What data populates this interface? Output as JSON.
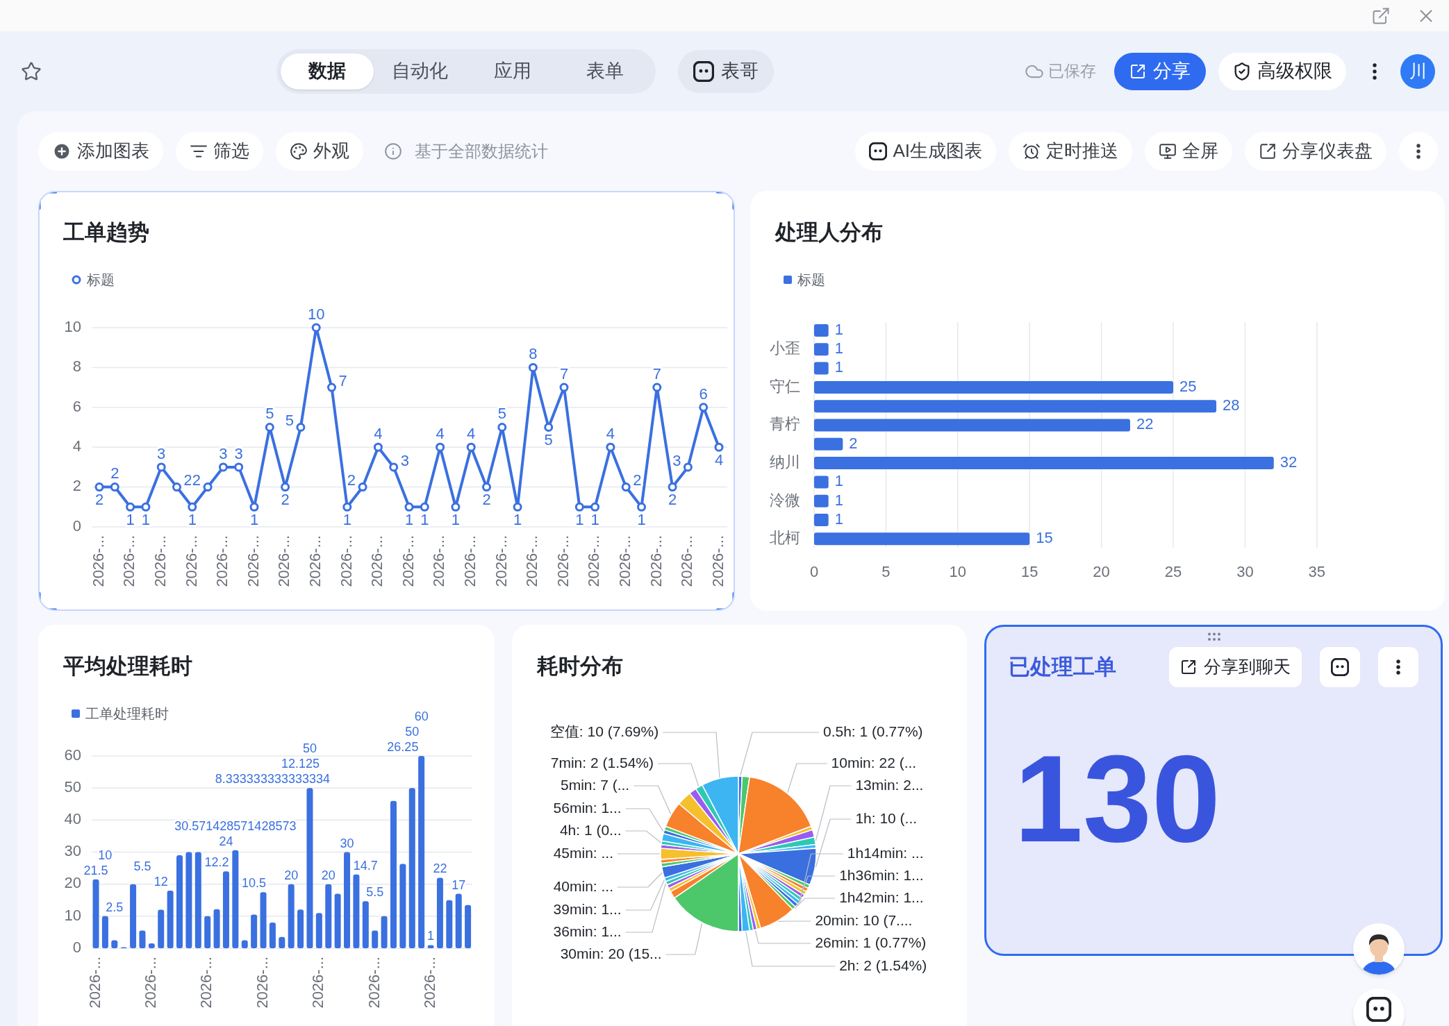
{
  "header": {
    "tabs": [
      {
        "label": "数据",
        "selected": true
      },
      {
        "label": "自动化",
        "selected": false
      },
      {
        "label": "应用",
        "selected": false
      },
      {
        "label": "表单",
        "selected": false
      }
    ],
    "assistant_button": "表哥",
    "save_status": "已保存",
    "share_button": "分享",
    "permissions_button": "高级权限",
    "user_avatar": "川"
  },
  "toolbar": {
    "left_buttons": [
      {
        "kind": "add",
        "label": "添加图表"
      },
      {
        "kind": "filter",
        "label": "筛选"
      },
      {
        "kind": "appearance",
        "label": "外观"
      }
    ],
    "info": "基于全部数据统计",
    "right_buttons": [
      {
        "kind": "ai",
        "label": "AI生成图表"
      },
      {
        "kind": "schedule",
        "label": "定时推送"
      },
      {
        "kind": "fullscreen",
        "label": "全屏"
      },
      {
        "kind": "share",
        "label": "分享仪表盘"
      }
    ]
  },
  "cards": [
    {
      "kind": "chart",
      "title": "工单趋势",
      "selected": true,
      "chart_data": {
        "type": "line",
        "data_labels": true,
        "grid": true,
        "marker": "circle",
        "ylim": [
          0,
          10
        ],
        "yticks": [
          0,
          2,
          4,
          6,
          8,
          10
        ],
        "categories": [
          "2026-...",
          null,
          "2026-...",
          null,
          "2026-...",
          null,
          "2026-...",
          null,
          "2026-...",
          null,
          "2026-...",
          null,
          "2026-...",
          null,
          "2026-...",
          null,
          "2026-...",
          null,
          "2026-...",
          null,
          "2026-...",
          null,
          "2026-...",
          null,
          "2026-...",
          null,
          "2026-...",
          null,
          "2026-...",
          null,
          "2026-...",
          null,
          "2026-...",
          null,
          "2026-...",
          null,
          "2026-...",
          null,
          "2026-...",
          null,
          "2026-..."
        ],
        "series": [
          {
            "name": "标题",
            "color": "#3a70e0",
            "values": [
              2,
              2,
              1,
              1,
              3,
              2,
              1,
              2,
              3,
              3,
              1,
              5,
              2,
              5,
              10,
              7,
              1,
              2,
              4,
              3,
              1,
              1,
              4,
              1,
              4,
              2,
              5,
              1,
              8,
              5,
              7,
              1,
              1,
              4,
              2,
              1,
              7,
              2,
              3,
              6,
              4
            ]
          }
        ]
      }
    },
    {
      "kind": "chart",
      "title": "处理人分布",
      "selected": false,
      "chart_data": {
        "type": "bar",
        "orientation": "horizontal",
        "data_labels": true,
        "grid": true,
        "xlim": [
          0,
          35
        ],
        "xticks": [
          0,
          5,
          10,
          15,
          20,
          25,
          30,
          35
        ],
        "categories": [
          null,
          "小歪",
          null,
          "守仁",
          null,
          "青柠",
          null,
          "纳川",
          null,
          "泠微",
          null,
          "北柯"
        ],
        "series": [
          {
            "name": "标题",
            "color": "#3a70e0",
            "values": [
              1,
              1,
              1,
              25,
              28,
              22,
              2,
              32,
              1,
              1,
              1,
              15
            ]
          }
        ]
      }
    },
    {
      "kind": "chart",
      "title": "平均处理耗时",
      "selected": false,
      "chart_data": {
        "type": "bar",
        "orientation": "vertical",
        "grid": true,
        "ylim": [
          0,
          60
        ],
        "yticks": [
          0,
          10,
          20,
          30,
          40,
          50,
          60
        ],
        "categories": [
          "2026-...",
          null,
          null,
          null,
          null,
          null,
          "2026-...",
          null,
          null,
          null,
          null,
          null,
          "2026-...",
          null,
          null,
          null,
          null,
          null,
          "2026-...",
          null,
          null,
          null,
          null,
          null,
          "2026-...",
          null,
          null,
          null,
          null,
          null,
          "2026-...",
          null,
          null,
          null,
          null,
          null,
          "2026-...",
          null,
          null,
          null,
          null
        ],
        "series": [
          {
            "name": "工单处理耗时",
            "color": "#3a70e0",
            "values": [
              21.5,
              10,
              2.5,
              0.3,
              20,
              5.5,
              1.5,
              12,
              18,
              29,
              30,
              30,
              10,
              12.2,
              24,
              30.6,
              2.5,
              10.5,
              17.5,
              8,
              3.5,
              20,
              12.1,
              50,
              11,
              20,
              17,
              30,
              23,
              14.7,
              5.5,
              10,
              46,
              26.3,
              50,
              60,
              1,
              22,
              15,
              17,
              13.5
            ]
          }
        ],
        "value_labels": [
          "21.5",
          "10",
          "2.5",
          null,
          null,
          "5.5",
          null,
          "12",
          null,
          null,
          null,
          null,
          null,
          "12.2",
          "24",
          "30.571428571428573",
          null,
          "10.5",
          null,
          "8.333333333333334",
          null,
          "20",
          "12.125",
          "50",
          null,
          "20",
          null,
          "30",
          null,
          "14.7",
          "5.5",
          null,
          null,
          "26.25",
          "50",
          "60",
          "1",
          "22",
          null,
          "17",
          null
        ]
      }
    },
    {
      "kind": "chart",
      "title": "耗时分布",
      "selected": false,
      "chart_data": {
        "type": "pie",
        "values": [
          1,
          2,
          22,
          1,
          2,
          2,
          1,
          10,
          1,
          1,
          1,
          1,
          1,
          1,
          1,
          1,
          10,
          1,
          1,
          1,
          2,
          1,
          20,
          2,
          1,
          1,
          1,
          1,
          3,
          1,
          1,
          3,
          1,
          1,
          2,
          1,
          1,
          7,
          4,
          2,
          2,
          10
        ],
        "value_labels": [
          "0.5h: 1 (0.77%)",
          null,
          "10min: 22 (...",
          null,
          null,
          "13min: 2...",
          null,
          "1h: 10 (...",
          null,
          null,
          null,
          null,
          null,
          "1h14min: ...",
          "1h36min: 1...",
          "1h42min: 1...",
          "20min: 10 (7....",
          null,
          "26min: 1 (0.77%)",
          null,
          "2h: 2 (1.54%)",
          null,
          "30min: 20 (15...",
          null,
          null,
          null,
          "36min: 1...",
          "39min: 1...",
          "40min: ...",
          null,
          null,
          "45min: ...",
          null,
          "4h: 1 (0...",
          null,
          "56min: 1...",
          null,
          "5min: 7 (...",
          null,
          null,
          "7min: 2 (1.54%)",
          "空值: 10 (7.69%)"
        ]
      }
    },
    {
      "kind": "metric",
      "title": "已处理工单",
      "hovered": true,
      "value": "130",
      "share_button": "分享到聊天"
    }
  ]
}
